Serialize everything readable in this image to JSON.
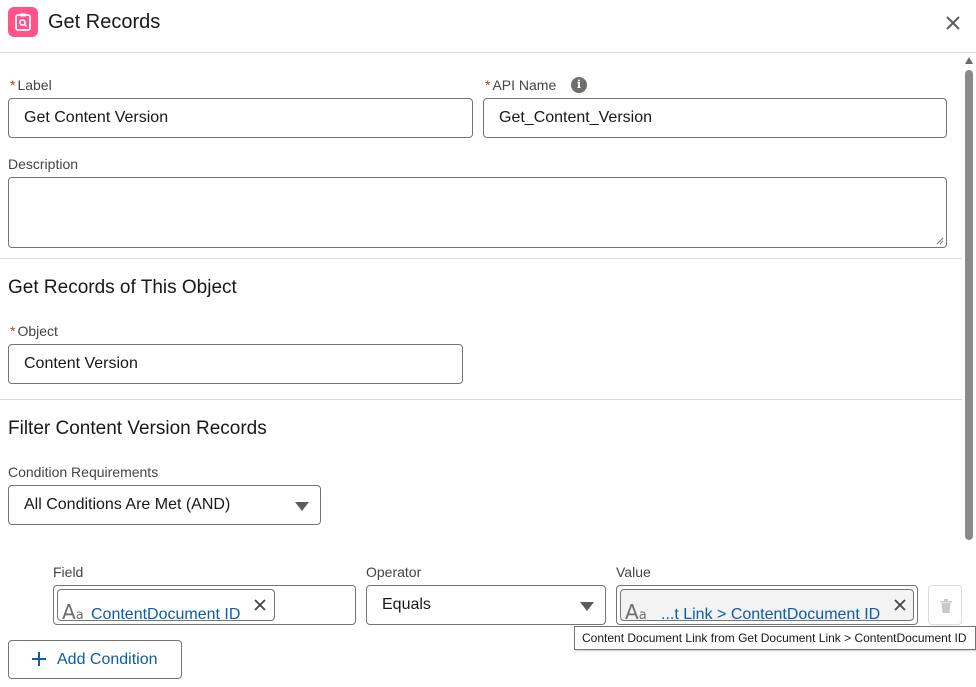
{
  "header": {
    "title": "Get Records",
    "icon": "clipboard-search-icon",
    "accent_color": "#ff538a"
  },
  "form": {
    "required_marker": "*",
    "label_field": {
      "label": "Label",
      "value": "Get Content Version"
    },
    "api_name_field": {
      "label": "API Name",
      "value": "Get_Content_Version",
      "info_glyph": "i"
    },
    "description_field": {
      "label": "Description",
      "value": ""
    }
  },
  "object_section": {
    "title": "Get Records of This Object",
    "object_field": {
      "label": "Object",
      "value": "Content Version"
    }
  },
  "filter_section": {
    "title": "Filter Content Version Records",
    "condition_requirements": {
      "label": "Condition Requirements",
      "value": "All Conditions Are Met (AND)"
    },
    "condition_row": {
      "field_label": "Field",
      "field_value": "ContentDocument ID",
      "operator_label": "Operator",
      "operator_value": "Equals",
      "value_label": "Value",
      "value_value": "...t Link > ContentDocument ID"
    },
    "tooltip": "Content Document Link from Get Document Link > ContentDocument ID",
    "add_condition_label": "Add Condition"
  },
  "text_type_glyph": {
    "big": "A",
    "small": "a"
  }
}
